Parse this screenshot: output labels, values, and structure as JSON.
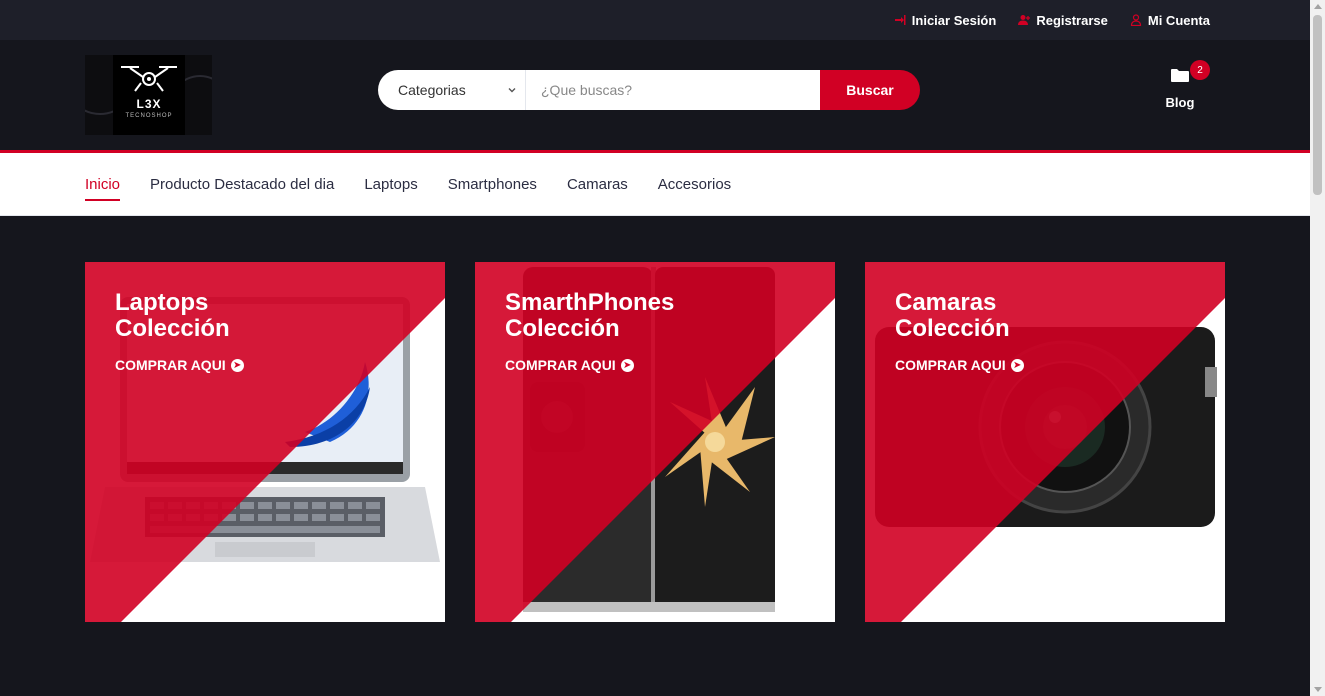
{
  "top_bar": {
    "links": [
      {
        "label": "Iniciar Sesión",
        "icon": "sign-in-icon"
      },
      {
        "label": "Registrarse",
        "icon": "user-plus-icon"
      },
      {
        "label": "Mi Cuenta",
        "icon": "user-icon"
      }
    ]
  },
  "header": {
    "logo_text": "L3X",
    "logo_sub": "TECNOSHOP",
    "search": {
      "category_label": "Categorias",
      "placeholder": "¿Que buscas?",
      "button_label": "Buscar"
    },
    "blog": {
      "label": "Blog",
      "badge_count": "2"
    }
  },
  "nav": {
    "items": [
      "Inicio",
      "Producto Destacado del dia",
      "Laptops",
      "Smartphones",
      "Camaras",
      "Accesorios"
    ],
    "active_index": 0
  },
  "collections": [
    {
      "title_line1": "Laptops",
      "title_line2": "Colección",
      "cta": "COMPRAR AQUI"
    },
    {
      "title_line1": "SmarthPhones",
      "title_line2": "Colección",
      "cta": "COMPRAR AQUI"
    },
    {
      "title_line1": "Camaras",
      "title_line2": "Colección",
      "cta": "COMPRAR AQUI"
    }
  ],
  "colors": {
    "accent": "#D10024",
    "background": "#15161D",
    "top_strip": "#1E1F29"
  }
}
